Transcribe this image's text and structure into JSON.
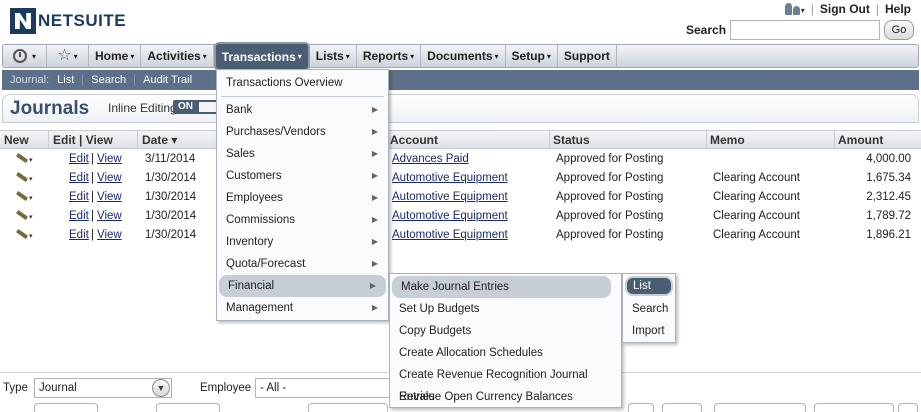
{
  "brand": {
    "name": "NETSUITE"
  },
  "top_links": {
    "sign_out": "Sign Out",
    "help": "Help",
    "separator": "|"
  },
  "search": {
    "label": "Search",
    "value": "",
    "go_label": "Go"
  },
  "nav": {
    "items": [
      {
        "label": "Home",
        "caret": "▾"
      },
      {
        "label": "Activities",
        "caret": "▾"
      },
      {
        "label": "Transactions",
        "caret": "▾"
      },
      {
        "label": "Lists",
        "caret": "▾"
      },
      {
        "label": "Reports",
        "caret": "▾"
      },
      {
        "label": "Documents",
        "caret": "▾"
      },
      {
        "label": "Setup",
        "caret": "▾"
      },
      {
        "label": "Support",
        "caret": ""
      }
    ]
  },
  "subnav": {
    "label": "Journal:",
    "links": [
      "List",
      "Search",
      "Audit Trail"
    ]
  },
  "page": {
    "title": "Journals",
    "inline_editing_label": "Inline Editing",
    "inline_editing_state": "ON"
  },
  "table": {
    "headers": {
      "new": "New",
      "edit_view": "Edit | View",
      "date": "Date ▾",
      "account": "Account",
      "status": "Status",
      "memo": "Memo",
      "amount": "Amount"
    },
    "rows": [
      {
        "edit": "Edit",
        "view": "View",
        "date": "3/11/2014",
        "account": "Advances Paid",
        "status": "Approved for Posting",
        "memo": "",
        "amount": "4,000.00"
      },
      {
        "edit": "Edit",
        "view": "View",
        "date": "1/30/2014",
        "account": "Automotive Equipment",
        "status": "Approved for Posting",
        "memo": "Clearing Account",
        "amount": "1,675.34"
      },
      {
        "edit": "Edit",
        "view": "View",
        "date": "1/30/2014",
        "account": "Automotive Equipment",
        "status": "Approved for Posting",
        "memo": "Clearing Account",
        "amount": "2,312.45"
      },
      {
        "edit": "Edit",
        "view": "View",
        "date": "1/30/2014",
        "account": "Automotive Equipment",
        "status": "Approved for Posting",
        "memo": "Clearing Account",
        "amount": "1,789.72"
      },
      {
        "edit": "Edit",
        "view": "View",
        "date": "1/30/2014",
        "account": "Automotive Equipment",
        "status": "Approved for Posting",
        "memo": "Clearing Account",
        "amount": "1,896.21"
      }
    ]
  },
  "transactions_menu": {
    "overview": "Transactions Overview",
    "items": [
      "Bank",
      "Purchases/Vendors",
      "Sales",
      "Customers",
      "Employees",
      "Commissions",
      "Inventory",
      "Quota/Forecast",
      "Financial",
      "Management"
    ]
  },
  "financial_menu": {
    "items": [
      "Make Journal Entries",
      "Set Up Budgets",
      "Copy Budgets",
      "Create Allocation Schedules",
      "Create Revenue Recognition Journal Entries",
      "Revalue Open Currency Balances"
    ]
  },
  "journal_menu": {
    "items": [
      "List",
      "Search",
      "Import"
    ]
  },
  "filters": {
    "type_label": "Type",
    "type_value": "Journal",
    "employee_label": "Employee",
    "employee_value": "- All -"
  },
  "colors": {
    "nav_active": "#4b5d73",
    "subnav": "#5c7089",
    "title": "#36506e",
    "link": "#1a2a6c"
  }
}
